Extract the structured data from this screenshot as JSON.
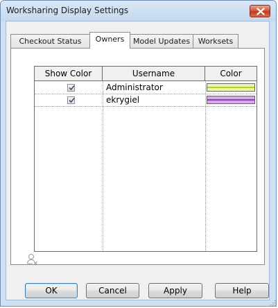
{
  "window": {
    "title": "Worksharing Display Settings",
    "close_icon": "close-icon"
  },
  "tabs": [
    {
      "label": "Checkout Status",
      "active": false
    },
    {
      "label": "Owners",
      "active": true
    },
    {
      "label": "Model Updates",
      "active": false
    },
    {
      "label": "Worksets",
      "active": false
    }
  ],
  "table": {
    "headers": {
      "show_color": "Show Color",
      "username": "Username",
      "color": "Color"
    },
    "rows": [
      {
        "show_color": true,
        "username": "Administrator",
        "color": "#d4ef5a"
      },
      {
        "show_color": true,
        "username": "ekrygiel",
        "color": "#b96ad1"
      }
    ]
  },
  "footer_icon": "remove-user-icon",
  "buttons": {
    "ok": "OK",
    "cancel": "Cancel",
    "apply": "Apply",
    "help": "Help"
  }
}
